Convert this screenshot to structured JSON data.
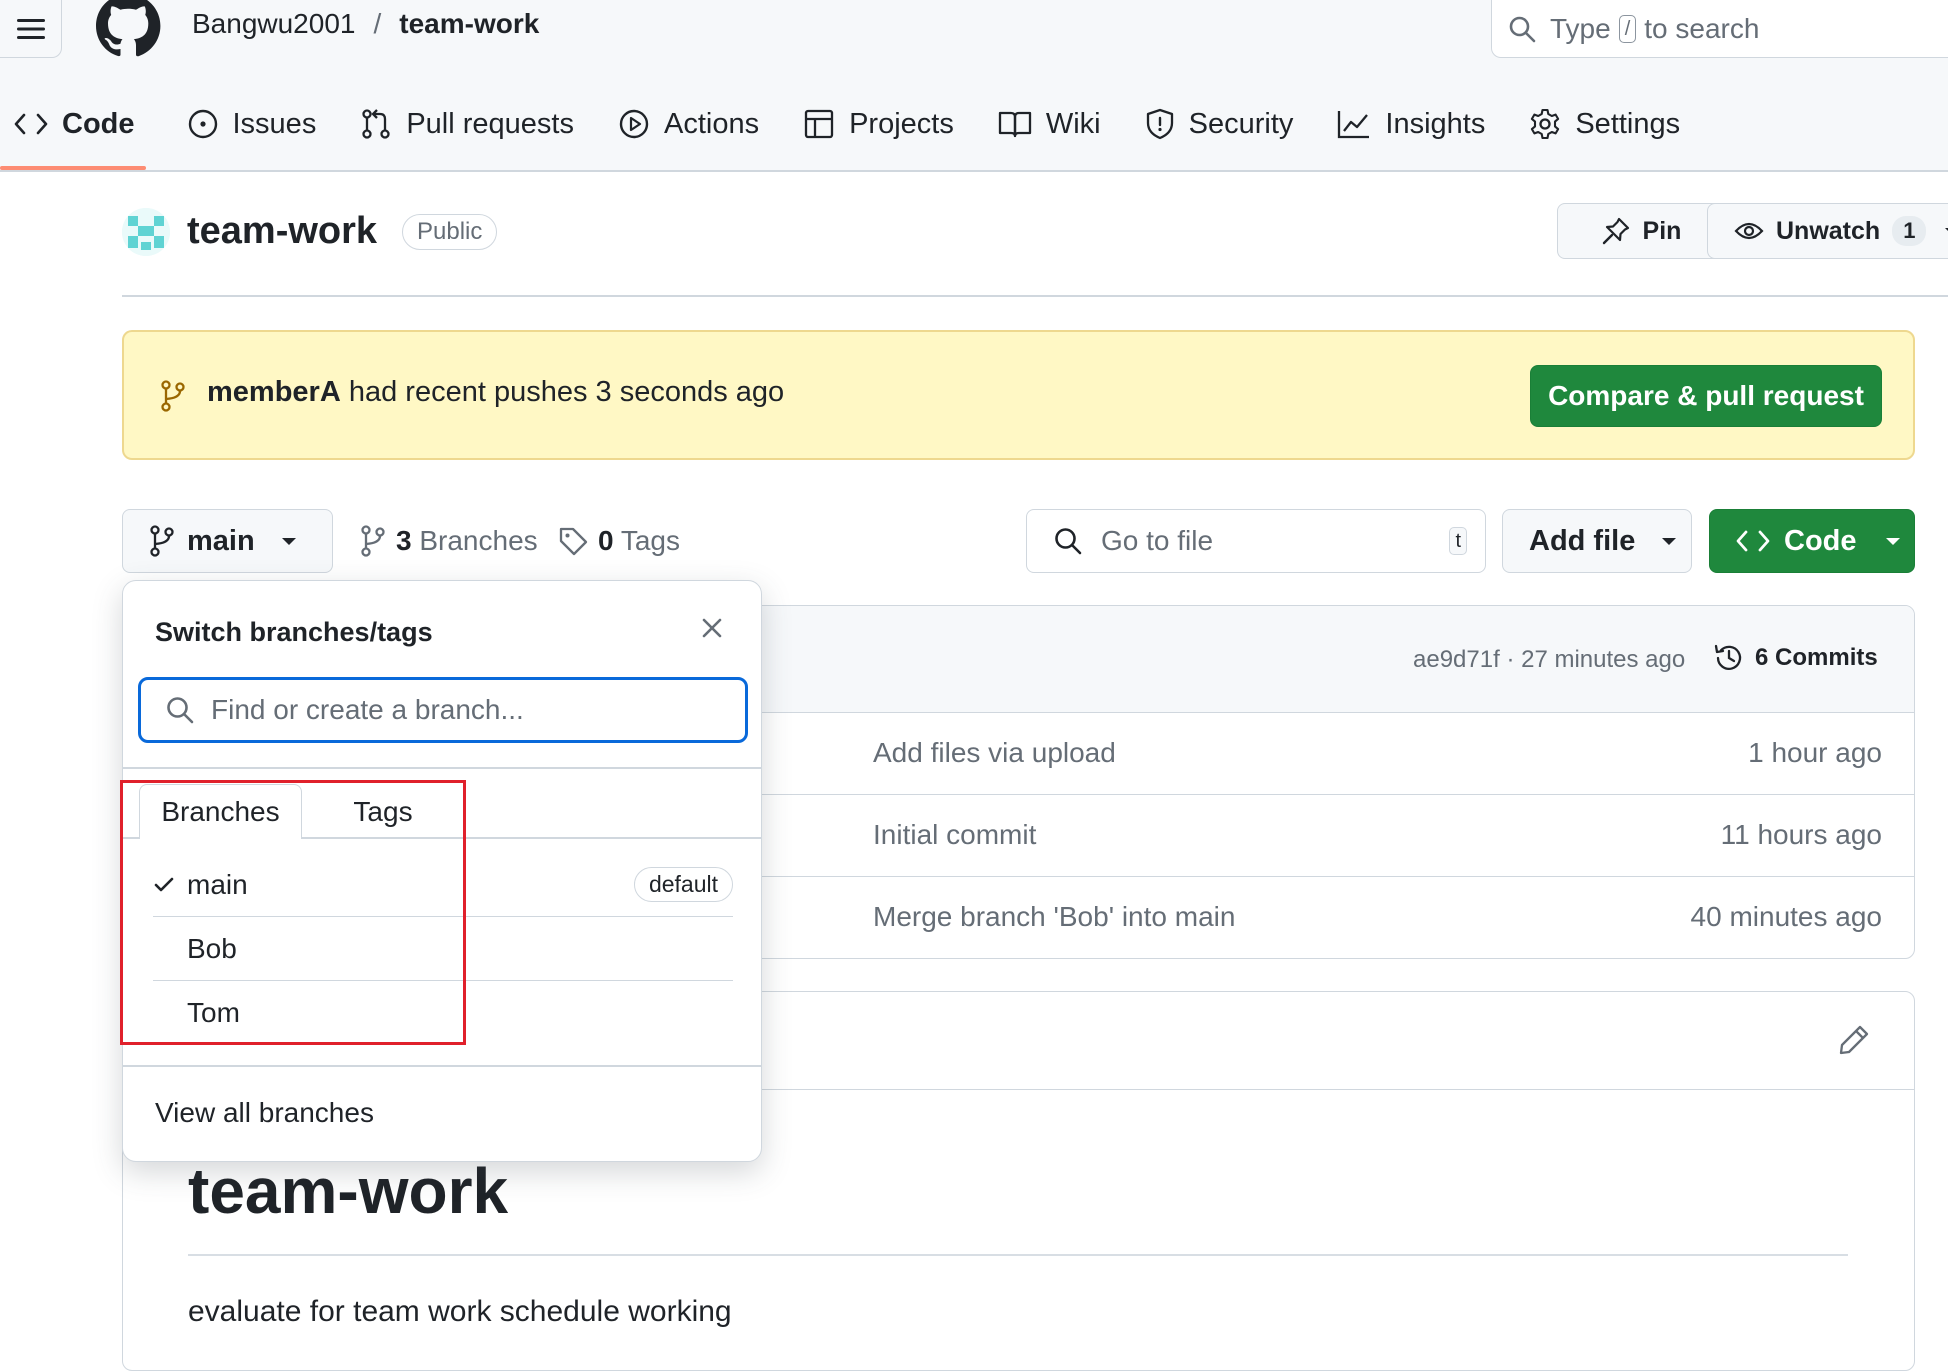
{
  "header": {
    "owner": "Bangwu2001",
    "separator": "/",
    "repo": "team-work",
    "search_placeholder_prefix": "Type",
    "search_key": "/",
    "search_placeholder_suffix": "to search"
  },
  "nav": {
    "items": [
      {
        "label": "Code",
        "icon": "code-icon",
        "active": true
      },
      {
        "label": "Issues",
        "icon": "issue-icon"
      },
      {
        "label": "Pull requests",
        "icon": "pull-request-icon"
      },
      {
        "label": "Actions",
        "icon": "play-icon"
      },
      {
        "label": "Projects",
        "icon": "table-icon"
      },
      {
        "label": "Wiki",
        "icon": "book-icon"
      },
      {
        "label": "Security",
        "icon": "shield-icon"
      },
      {
        "label": "Insights",
        "icon": "graph-icon"
      },
      {
        "label": "Settings",
        "icon": "gear-icon"
      }
    ],
    "active_underline_color": "#fd8c73"
  },
  "repo_header": {
    "name": "team-work",
    "visibility": "Public",
    "pin_label": "Pin",
    "unwatch_label": "Unwatch",
    "watch_count": "1"
  },
  "flash": {
    "user": "memberA",
    "message": "had recent pushes 3 seconds ago",
    "button": "Compare & pull request"
  },
  "branch_bar": {
    "current_branch": "main",
    "branches_count": "3",
    "branches_label": "Branches",
    "tags_count": "0",
    "tags_label": "Tags",
    "goto_placeholder": "Go to file",
    "goto_key": "t",
    "add_file_label": "Add file",
    "code_label": "Code"
  },
  "latest_commit": {
    "hash": "ae9d71f",
    "separator": "·",
    "time": "27 minutes ago",
    "commits_count": "6",
    "commits_label": "Commits"
  },
  "file_rows": [
    {
      "message": "Add files via upload",
      "time": "1 hour ago"
    },
    {
      "message": "Initial commit",
      "time": "11 hours ago"
    },
    {
      "message": "Merge branch 'Bob' into main",
      "time": "40 minutes ago"
    }
  ],
  "readme": {
    "title": "team-work",
    "description": "evaluate for team work schedule working"
  },
  "branch_dropdown": {
    "title": "Switch branches/tags",
    "filter_placeholder": "Find or create a branch...",
    "tabs": [
      "Branches",
      "Tags"
    ],
    "branches": [
      {
        "name": "main",
        "selected": true,
        "badge": "default"
      },
      {
        "name": "Bob"
      },
      {
        "name": "Tom"
      }
    ],
    "view_all": "View all branches"
  },
  "colors": {
    "primary_green": "#1f883d",
    "flash_bg": "#fff8c5",
    "focus_blue": "#0969da",
    "highlight_red": "#e0202b"
  }
}
